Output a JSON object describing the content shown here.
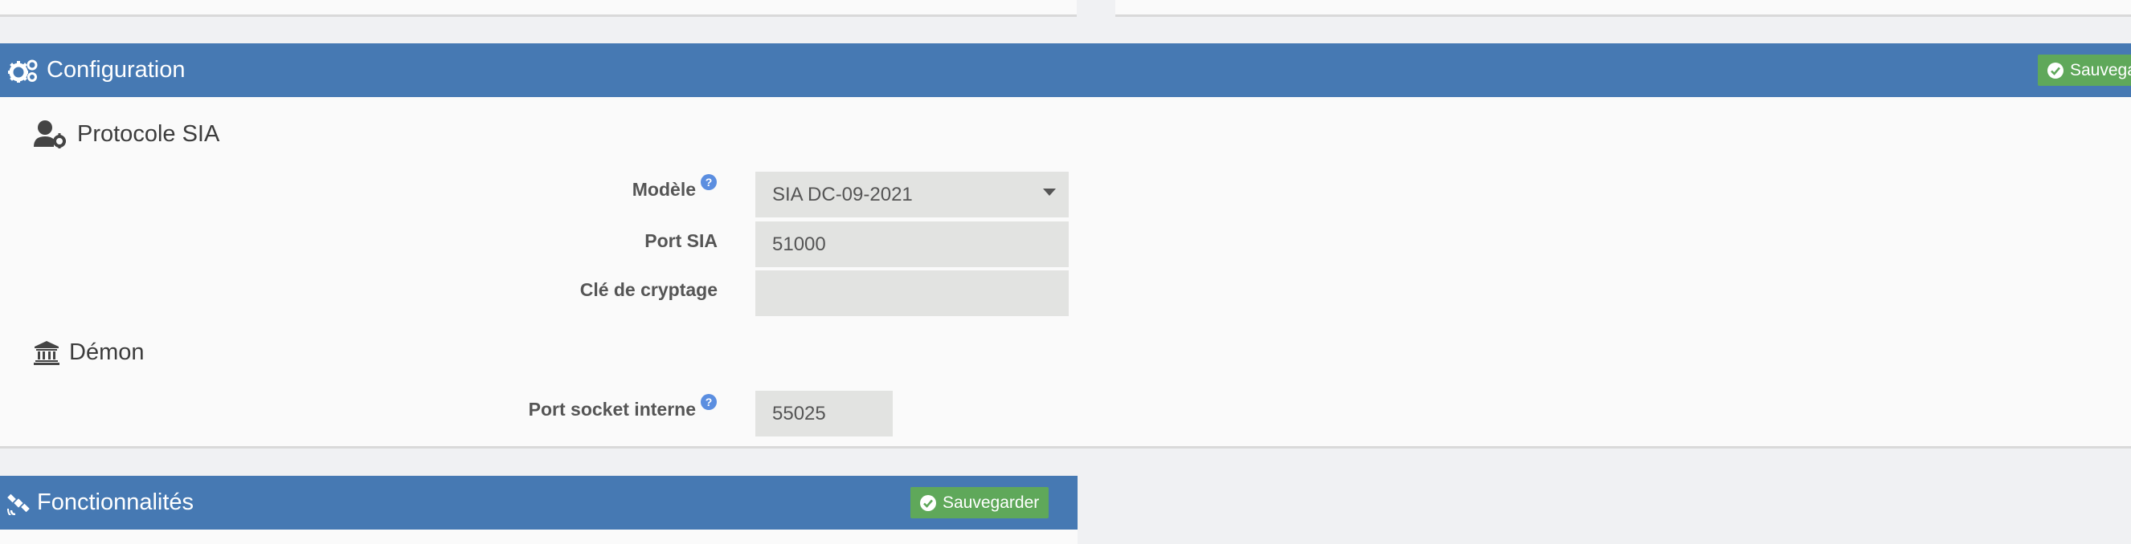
{
  "config_panel": {
    "title": "Configuration",
    "save_label": "Sauvegarder",
    "section_sia": {
      "title": "Protocole SIA",
      "fields": {
        "modele": {
          "label": "Modèle",
          "value": "SIA DC-09-2021",
          "help": "?"
        },
        "port_sia": {
          "label": "Port SIA",
          "value": "51000"
        },
        "cle": {
          "label": "Clé de cryptage",
          "value": ""
        }
      }
    },
    "section_demon": {
      "title": "Démon",
      "fields": {
        "port_socket": {
          "label": "Port socket interne",
          "value": "55025",
          "help": "?"
        }
      }
    }
  },
  "features_panel": {
    "title": "Fonctionnalités",
    "save_label": "Sauvegarder"
  },
  "colors": {
    "header_blue": "#4679b3",
    "save_green": "#5fa85a",
    "help_blue": "#5b8ee0"
  }
}
